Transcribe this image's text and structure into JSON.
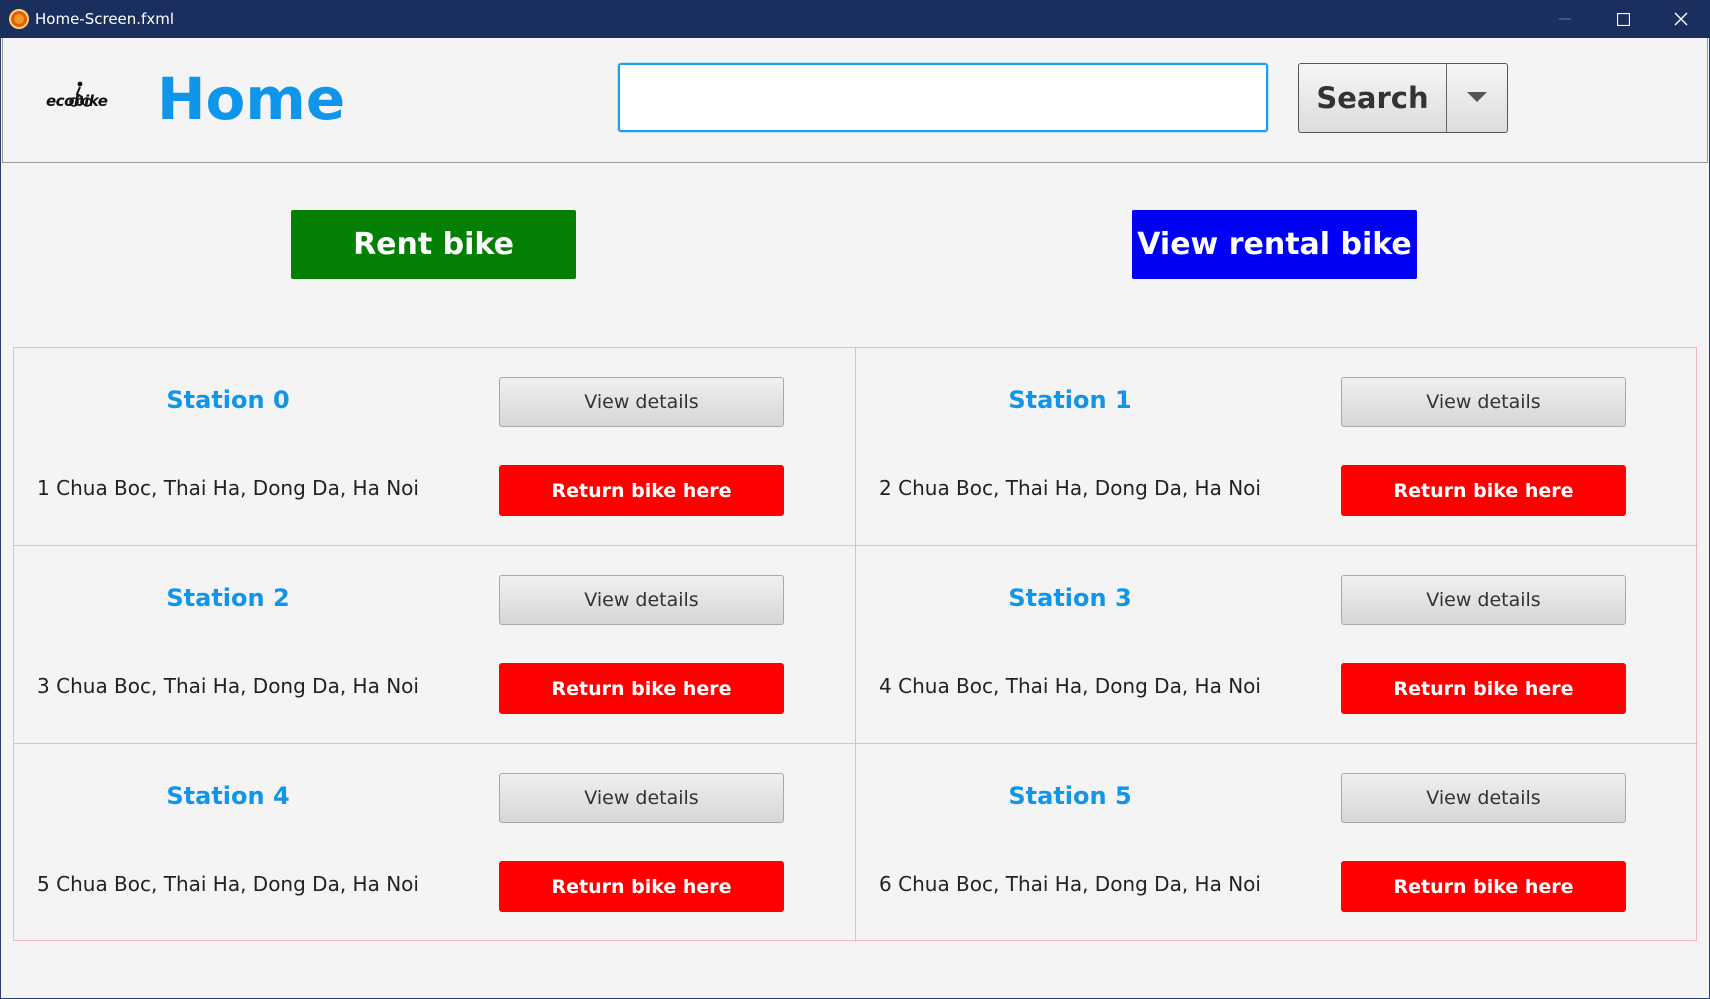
{
  "window": {
    "title": "Home-Screen.fxml",
    "titlebar_color": "#1b2f5e",
    "icons": [
      "app-icon",
      "minimize-icon",
      "maximize-icon",
      "close-icon"
    ]
  },
  "header": {
    "logo_text": "ecobike",
    "title": "Home",
    "title_color": "#0f96ea",
    "search": {
      "value": "",
      "placeholder": ""
    },
    "search_button": "Search",
    "dropdown_icon": "chevron-down-icon"
  },
  "actions": {
    "rent_label": "Rent bike",
    "rent_color": "#038003",
    "view_rental_label": "View rental bike",
    "view_rental_color": "#0000f5"
  },
  "stations": [
    {
      "name": "Station 0",
      "address": "1 Chua Boc, Thai Ha, Dong Da, Ha Noi",
      "details_label": "View details",
      "return_label": "Return bike here"
    },
    {
      "name": "Station 1",
      "address": "2 Chua Boc, Thai Ha, Dong Da, Ha Noi",
      "details_label": "View details",
      "return_label": "Return bike here"
    },
    {
      "name": "Station 2",
      "address": "3 Chua Boc, Thai Ha, Dong Da, Ha Noi",
      "details_label": "View details",
      "return_label": "Return bike here"
    },
    {
      "name": "Station 3",
      "address": "4 Chua Boc, Thai Ha, Dong Da, Ha Noi",
      "details_label": "View details",
      "return_label": "Return bike here"
    },
    {
      "name": "Station 4",
      "address": "5 Chua Boc, Thai Ha, Dong Da, Ha Noi",
      "details_label": "View details",
      "return_label": "Return bike here"
    },
    {
      "name": "Station 5",
      "address": "6 Chua Boc, Thai Ha, Dong Da, Ha Noi",
      "details_label": "View details",
      "return_label": "Return bike here"
    }
  ],
  "colors": {
    "station_name": "#0f96ea",
    "return_button": "#ff0000",
    "grid_border": "#f4b6c4"
  }
}
